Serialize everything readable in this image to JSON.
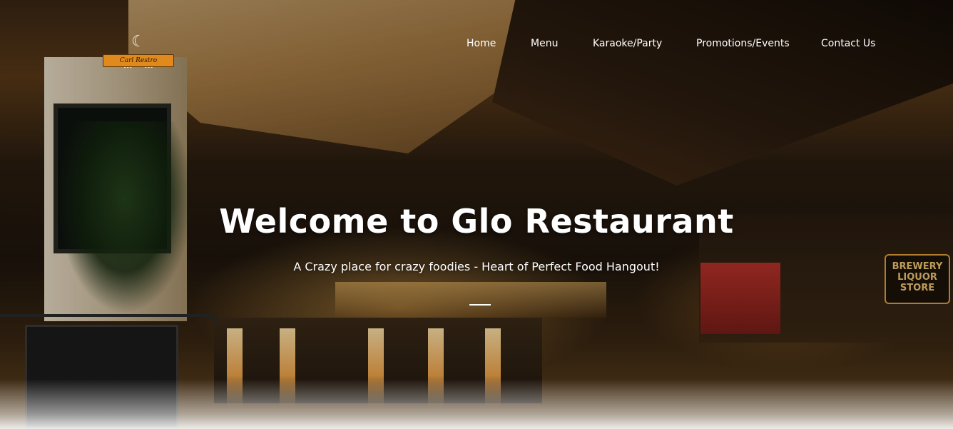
{
  "logo": {
    "text": "Carl Restro",
    "utensils_glyph": "☾ ⋔ ⋔",
    "accent_color": "#e08a1e"
  },
  "nav": {
    "items": [
      {
        "label": "Home"
      },
      {
        "label": "Menu"
      },
      {
        "label": "Karaoke/Party"
      },
      {
        "label": "Promotions/Events"
      },
      {
        "label": "Contact Us"
      }
    ]
  },
  "hero": {
    "title": "Welcome to Glo Restaurant",
    "subtitle": "A Crazy place for crazy foodies - Heart of Perfect Food Hangout!",
    "sign_text": "BREWERY LIQUOR STORE"
  }
}
